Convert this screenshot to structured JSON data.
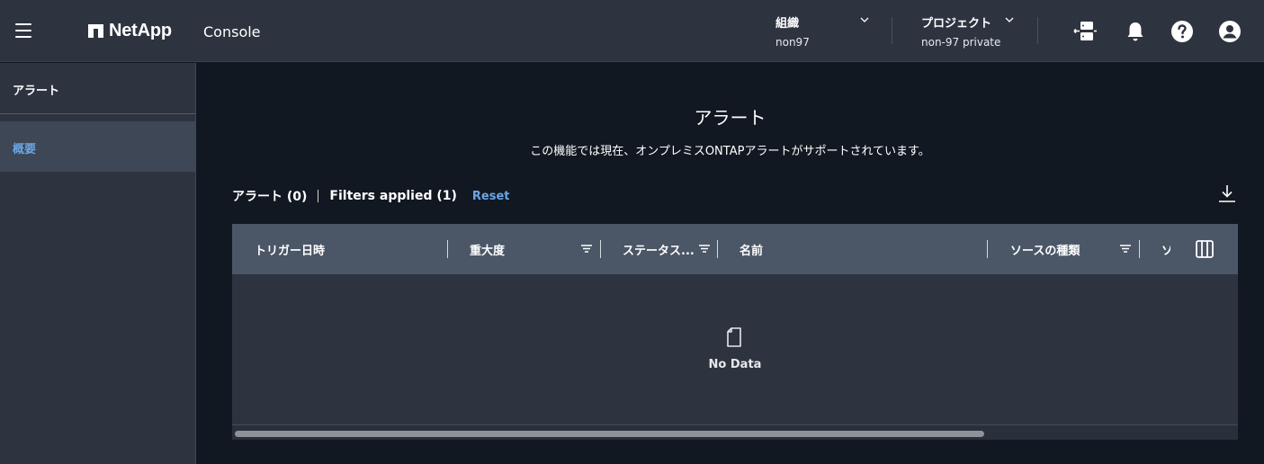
{
  "header": {
    "logo_text": "NetApp",
    "app_name": "Console",
    "org": {
      "label": "組織",
      "value": "non97"
    },
    "project": {
      "label": "プロジェクト",
      "value": "non-97 private"
    },
    "icons": [
      "menu-icon",
      "connector-icon",
      "bell-icon",
      "help-icon",
      "user-icon"
    ]
  },
  "sidebar": {
    "title": "アラート",
    "items": [
      {
        "label": "概要",
        "selected": true
      }
    ]
  },
  "main": {
    "title": "アラート",
    "subtitle": "この機能では現在、オンプレミスONTAPアラートがサポートされています。",
    "toolbar": {
      "count_label": "アラート (0)",
      "filters_label": "Filters applied (1)",
      "reset_label": "Reset"
    },
    "table": {
      "columns": [
        "トリガー日時",
        "重大度",
        "ステータス...",
        "名前",
        "ソースの種類",
        "ソ"
      ],
      "empty_text": "No Data",
      "scroll_fraction": 0.75
    }
  },
  "colors": {
    "topbar_bg": "#2d3440",
    "page_bg": "#121821",
    "accent": "#6aa6e6",
    "table_header_bg": "#4b5666"
  }
}
